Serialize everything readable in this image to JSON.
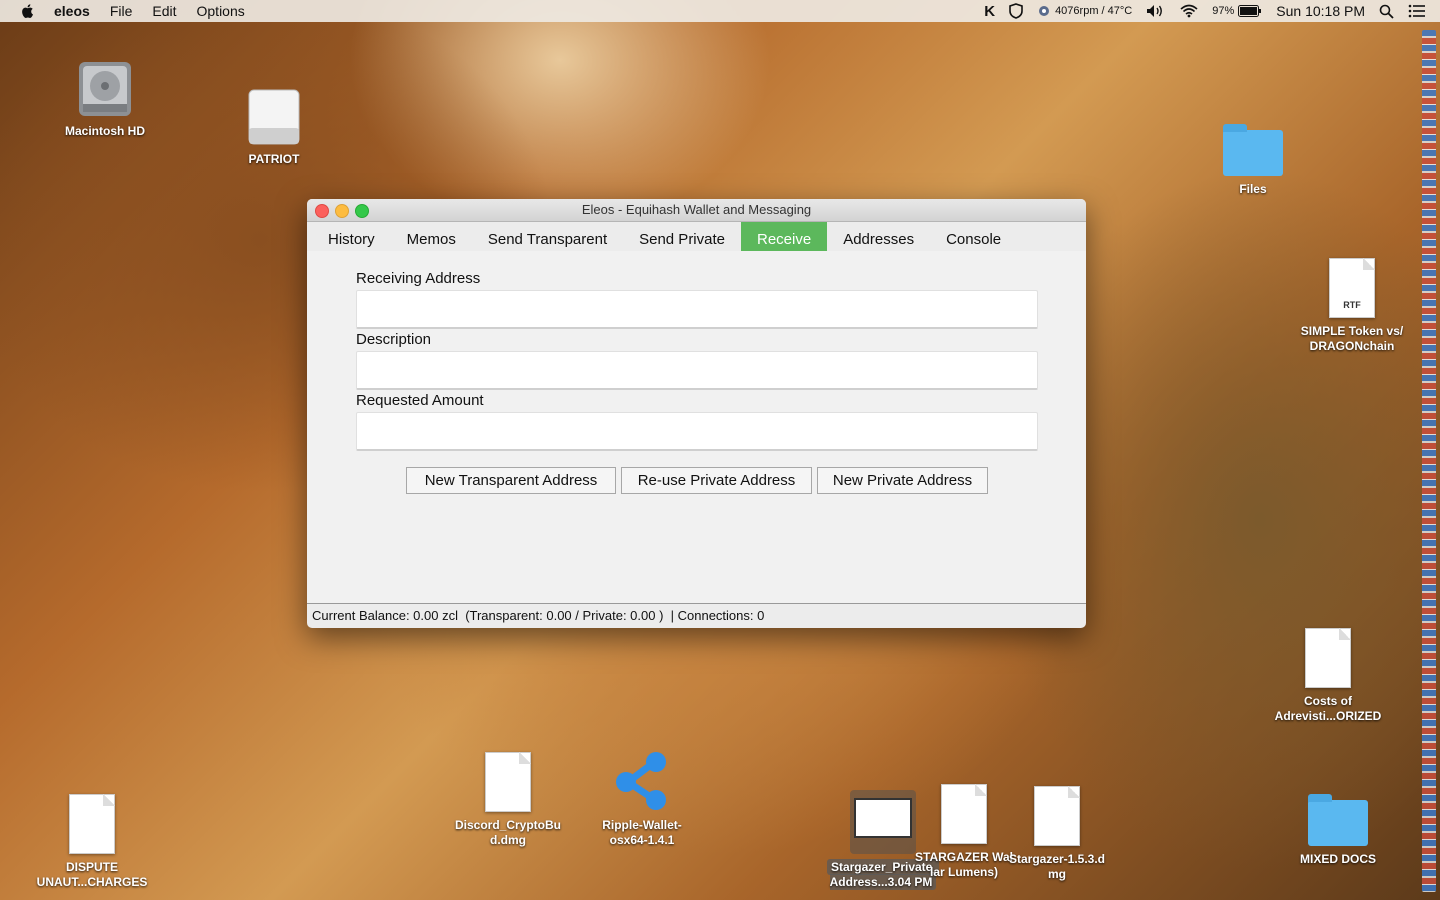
{
  "menubar": {
    "app_name": "eleos",
    "menus": [
      "File",
      "Edit",
      "Options"
    ],
    "status": {
      "fan_temp": "4076rpm / 47°C",
      "battery": "97%",
      "clock": "Sun 10:18 PM"
    }
  },
  "desktop": {
    "icons": {
      "macintosh_hd": "Macintosh HD",
      "patriot": "PATRIOT",
      "files": "Files",
      "simple_token_line1": "SIMPLE Token vs/",
      "simple_token_line2": "DRAGONchain",
      "simple_token_badge": "RTF",
      "costs_line1": "Costs of",
      "costs_line2": "Adrevisti...ORIZED",
      "discord_line1": "Discord_CryptoBu",
      "discord_line2": "d.dmg",
      "ripple_line1": "Ripple-Wallet-",
      "ripple_line2": "osx64-1.4.1",
      "stargazer_private_line1": "Stargazer_Private_",
      "stargazer_private_line2": "Address...3.04 PM",
      "stargazer_wallet_line1": "STARGAZER Wal",
      "stargazer_wallet_line2": "lar Lumens)",
      "stargazer_dmg_line1": "Stargazer-1.5.3.d",
      "stargazer_dmg_line2": "mg",
      "mixed_docs": "MIXED DOCS",
      "dispute_line1": "DISPUTE",
      "dispute_line2": "UNAUT...CHARGES"
    }
  },
  "window": {
    "title": "Eleos - Equihash Wallet and Messaging",
    "tabs": [
      "History",
      "Memos",
      "Send Transparent",
      "Send Private",
      "Receive",
      "Addresses",
      "Console"
    ],
    "active_tab": "Receive",
    "form": {
      "receiving_address_label": "Receiving Address",
      "receiving_address_value": "",
      "description_label": "Description",
      "description_value": "",
      "requested_amount_label": "Requested Amount",
      "requested_amount_value": ""
    },
    "buttons": {
      "new_transparent": "New Transparent Address",
      "reuse_private": "Re-use Private Address",
      "new_private": "New Private Address"
    },
    "status_bar": "Current Balance: 0.00 zcl  (Transparent: 0.00 / Private: 0.00 )  | Connections: 0"
  },
  "colors": {
    "active_tab": "#5cb85c",
    "close": "#fc605c",
    "minimize": "#fdbc40",
    "maximize": "#34c84a"
  }
}
